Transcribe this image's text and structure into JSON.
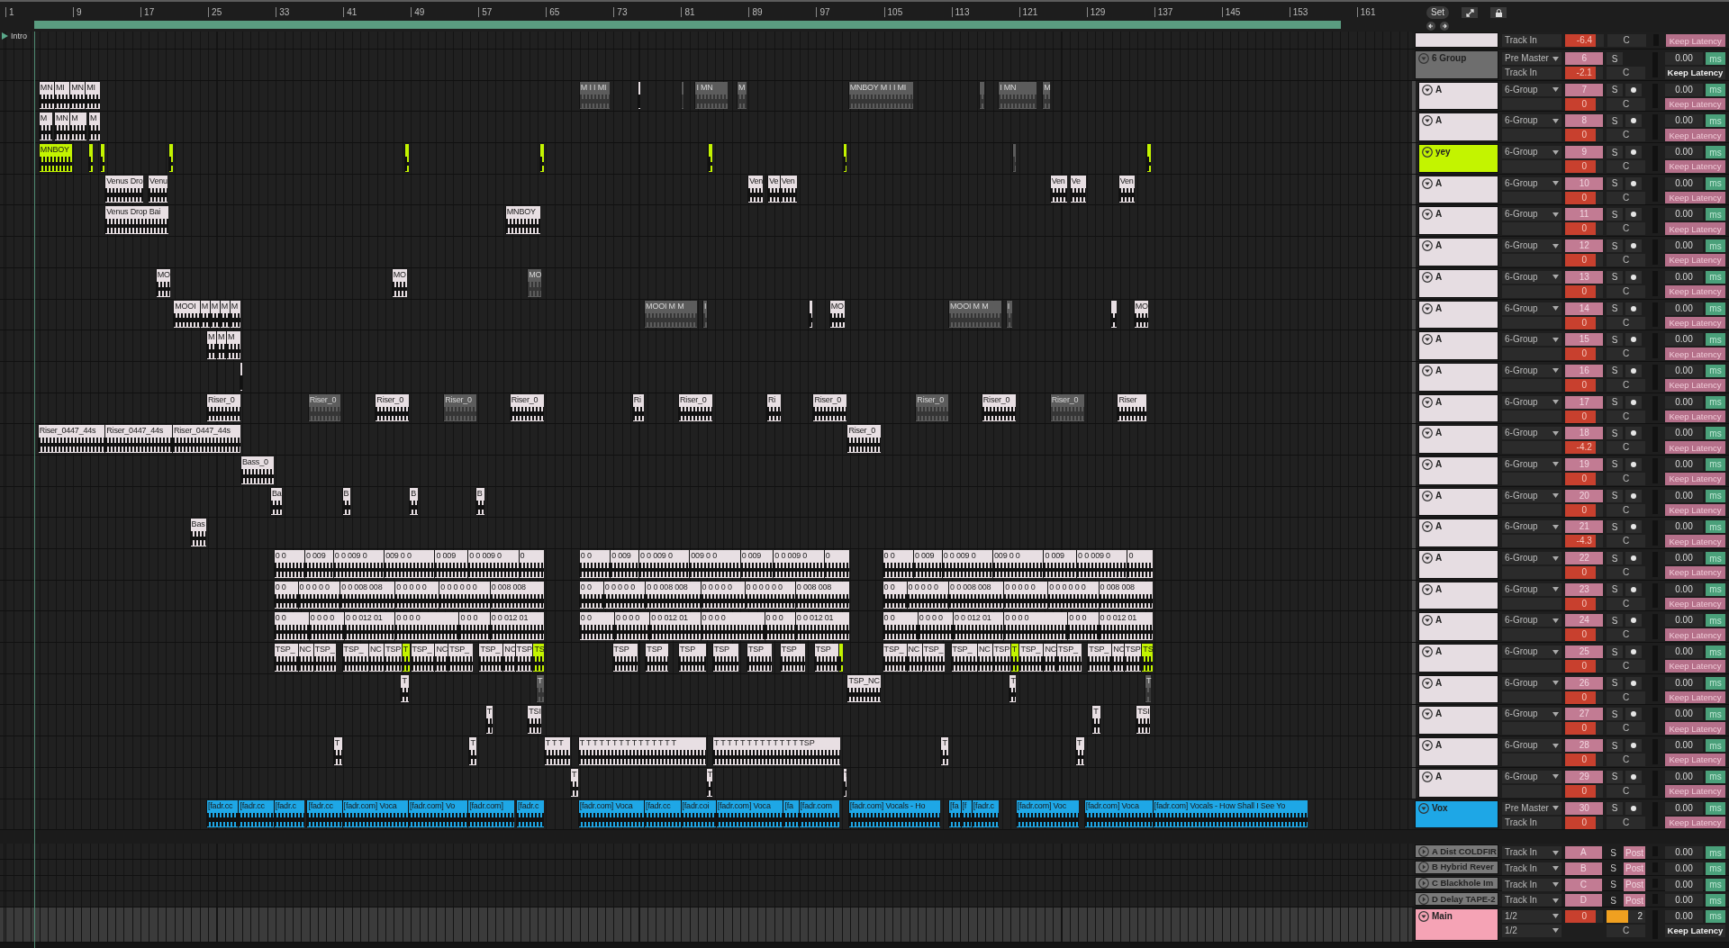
{
  "header": {
    "set_button": "Set"
  },
  "ruler": {
    "bars": [
      "1",
      "9",
      "17",
      "25",
      "33",
      "41",
      "49",
      "57",
      "65",
      "73",
      "81",
      "89",
      "97",
      "105",
      "113",
      "121",
      "129",
      "137",
      "145",
      "153",
      "161"
    ],
    "locator": "Intro"
  },
  "tracks": [
    {
      "kind": "partial",
      "color": "#e6dde2",
      "routing_sub": "Track In",
      "volume": "-6.4",
      "pan": "C",
      "keep_latency": {
        "label": "Keep Latency",
        "on": true
      }
    },
    {
      "kind": "group",
      "name": "6 Group",
      "color": "#6e6e6e",
      "expanded": true,
      "routing": "Pre Master",
      "routing_sub": "Track In",
      "number": "6",
      "volume": "-2.1",
      "solo": "S",
      "arm": false,
      "pan": "C",
      "delay": "0.00",
      "unit": "ms",
      "keep_latency": {
        "label": "Keep Latency",
        "on": false
      },
      "children": [
        {
          "kind": "track",
          "name": "A",
          "color": "#e6dde2",
          "expanded": true,
          "routing": "6-Group",
          "number": "7",
          "volume": "0",
          "solo": "S",
          "arm": true,
          "pan": "C",
          "delay": "0.00",
          "unit": "ms",
          "keep_latency": {
            "label": "Keep Latency",
            "on": true
          },
          "clips": [
            {
              "label": "MN",
              "color": "#e8dfe3",
              "active": true
            },
            {
              "label": "MI",
              "color": "#e8dfe3",
              "active": true
            },
            {
              "label": "MN",
              "color": "#e8dfe3",
              "active": true
            },
            {
              "label": "MI",
              "color": "#e8dfe3",
              "active": true
            },
            {
              "label": "M I I MI",
              "active": false
            },
            {
              "color": "#e8dfe3",
              "active": true
            },
            {
              "active": false
            },
            {
              "label": "I MN",
              "active": false
            },
            {
              "label": "M",
              "active": false
            },
            {
              "label": "MNBOY M I I MI",
              "active": false
            },
            {
              "active": false
            },
            {
              "label": "I MN",
              "active": false
            },
            {
              "label": "M",
              "active": false
            }
          ]
        },
        {
          "kind": "track",
          "name": "A",
          "color": "#e6dde2",
          "expanded": true,
          "routing": "6-Group",
          "number": "8",
          "volume": "0",
          "solo": "S",
          "arm": true,
          "pan": "C",
          "delay": "0.00",
          "unit": "ms",
          "keep_latency": {
            "label": "Keep Latency",
            "on": true
          },
          "clips": [
            {
              "label": "M",
              "color": "#e8dfe3",
              "active": true
            },
            {
              "label": "MN",
              "color": "#e8dfe3",
              "active": true
            },
            {
              "label": "M",
              "color": "#e8dfe3",
              "active": true
            },
            {
              "label": "M",
              "color": "#e8dfe3",
              "active": true
            }
          ]
        },
        {
          "kind": "track",
          "name": "yey",
          "color": "#c3f400",
          "expanded": true,
          "routing": "6-Group",
          "number": "9",
          "volume": "0",
          "solo": "S",
          "arm": true,
          "pan": "C",
          "delay": "0.00",
          "unit": "ms",
          "keep_latency": {
            "label": "Keep Latency",
            "on": true
          },
          "clips": [
            {
              "label": "MNBOY",
              "color": "#c3f400",
              "active": true
            },
            {
              "color": "#c3f400",
              "active": true
            },
            {
              "color": "#c3f400",
              "active": true
            },
            {
              "color": "#c3f400",
              "active": true
            },
            {
              "color": "#c3f400",
              "active": true
            },
            {
              "color": "#c3f400",
              "active": true
            },
            {
              "color": "#c3f400",
              "active": true
            },
            {
              "color": "#c3f400",
              "active": true
            },
            {
              "active": false
            },
            {
              "color": "#c3f400",
              "active": true
            }
          ]
        },
        {
          "kind": "track",
          "name": "A",
          "color": "#e6dde2",
          "expanded": true,
          "routing": "6-Group",
          "number": "10",
          "volume": "0",
          "solo": "S",
          "arm": true,
          "pan": "C",
          "delay": "0.00",
          "unit": "ms",
          "keep_latency": {
            "label": "Keep Latency",
            "on": true
          },
          "clips": [
            {
              "label": "Venus Dro",
              "color": "#e8dfe3",
              "active": true
            },
            {
              "label": "Venu",
              "color": "#e8dfe3",
              "active": true
            },
            {
              "label": "Ven",
              "color": "#e8dfe3",
              "active": true
            },
            {
              "label": "Ve",
              "color": "#e8dfe3",
              "active": true
            },
            {
              "label": "Ven",
              "color": "#e8dfe3",
              "active": true
            },
            {
              "label": "Ven",
              "color": "#e8dfe3",
              "active": true
            },
            {
              "label": "Ve",
              "color": "#e8dfe3",
              "active": true
            },
            {
              "label": "Ven",
              "color": "#e8dfe3",
              "active": true
            }
          ]
        },
        {
          "kind": "track",
          "name": "A",
          "color": "#e6dde2",
          "expanded": true,
          "routing": "6-Group",
          "number": "11",
          "volume": "0",
          "solo": "S",
          "arm": true,
          "pan": "C",
          "delay": "0.00",
          "unit": "ms",
          "keep_latency": {
            "label": "Keep Latency",
            "on": true
          },
          "clips": [
            {
              "label": "Venus Drop Bai",
              "color": "#e8dfe3",
              "active": true
            },
            {
              "label": "MNBOY",
              "color": "#e8dfe3",
              "active": true
            }
          ]
        },
        {
          "kind": "track",
          "name": "A",
          "color": "#e6dde2",
          "expanded": true,
          "routing": "6-Group",
          "number": "12",
          "volume": "0",
          "solo": "S",
          "arm": true,
          "pan": "C",
          "delay": "0.00",
          "unit": "ms",
          "keep_latency": {
            "label": "Keep Latency",
            "on": true
          }
        },
        {
          "kind": "track",
          "name": "A",
          "color": "#e6dde2",
          "expanded": true,
          "routing": "6-Group",
          "number": "13",
          "volume": "0",
          "solo": "S",
          "arm": true,
          "pan": "C",
          "delay": "0.00",
          "unit": "ms",
          "keep_latency": {
            "label": "Keep Latency",
            "on": true
          },
          "clips": [
            {
              "label": "MO",
              "color": "#e8dfe3",
              "active": true
            },
            {
              "label": "MO",
              "color": "#e8dfe3",
              "active": true
            },
            {
              "label": "MO",
              "active": false
            }
          ]
        },
        {
          "kind": "track",
          "name": "A",
          "color": "#e6dde2",
          "expanded": true,
          "routing": "6-Group",
          "number": "14",
          "volume": "0",
          "solo": "S",
          "arm": true,
          "pan": "C",
          "delay": "0.00",
          "unit": "ms",
          "keep_latency": {
            "label": "Keep Latency",
            "on": true
          },
          "clips": [
            {
              "label": "MOOI",
              "color": "#e8dfe3",
              "active": true
            },
            {
              "label": "M",
              "color": "#e8dfe3",
              "active": true
            },
            {
              "label": "M",
              "color": "#e8dfe3",
              "active": true
            },
            {
              "label": "M",
              "color": "#e8dfe3",
              "active": true
            },
            {
              "label": "M",
              "color": "#e8dfe3",
              "active": true
            },
            {
              "label": "MOOI M M",
              "active": false
            },
            {
              "label": "I",
              "active": false
            },
            {
              "color": "#e8dfe3",
              "active": true
            },
            {
              "label": "MO",
              "color": "#e8dfe3",
              "active": true
            },
            {
              "label": "MOOI M M",
              "active": false
            },
            {
              "label": "I",
              "active": false
            },
            {
              "color": "#e8dfe3",
              "active": true
            },
            {
              "label": "MO",
              "color": "#e8dfe3",
              "active": true
            }
          ]
        },
        {
          "kind": "track",
          "name": "A",
          "color": "#e6dde2",
          "expanded": true,
          "routing": "6-Group",
          "number": "15",
          "volume": "0",
          "solo": "S",
          "arm": true,
          "pan": "C",
          "delay": "0.00",
          "unit": "ms",
          "keep_latency": {
            "label": "Keep Latency",
            "on": true
          },
          "clips": [
            {
              "label": "M",
              "color": "#e8dfe3",
              "active": true
            },
            {
              "label": "M",
              "color": "#e8dfe3",
              "active": true
            },
            {
              "label": "M",
              "color": "#e8dfe3",
              "active": true
            }
          ]
        },
        {
          "kind": "track",
          "name": "A",
          "color": "#e6dde2",
          "expanded": true,
          "routing": "6-Group",
          "number": "16",
          "volume": "0",
          "solo": "S",
          "arm": true,
          "pan": "C",
          "delay": "0.00",
          "unit": "ms",
          "keep_latency": {
            "label": "Keep Latency",
            "on": true
          },
          "clips": [
            {
              "color": "#e8dfe3",
              "active": true
            }
          ]
        },
        {
          "kind": "track",
          "name": "A",
          "color": "#e6dde2",
          "expanded": true,
          "routing": "6-Group",
          "number": "17",
          "volume": "0",
          "solo": "S",
          "arm": true,
          "pan": "C",
          "delay": "0.00",
          "unit": "ms",
          "keep_latency": {
            "label": "Keep Latency",
            "on": true
          },
          "clips": [
            {
              "label": "Riser_0",
              "color": "#e8dfe3",
              "active": true
            },
            {
              "label": "Riser_0",
              "active": false
            },
            {
              "label": "Riser_0",
              "color": "#e8dfe3",
              "active": true
            },
            {
              "label": "Riser_0",
              "active": false
            },
            {
              "label": "Riser_0",
              "color": "#e8dfe3",
              "active": true
            },
            {
              "label": "Ri",
              "color": "#e8dfe3",
              "active": true
            },
            {
              "label": "Riser_0",
              "color": "#e8dfe3",
              "active": true
            },
            {
              "label": "Ri",
              "color": "#e8dfe3",
              "active": true
            },
            {
              "label": "Riser_0",
              "color": "#e8dfe3",
              "active": true
            },
            {
              "label": "Riser_0",
              "active": false
            },
            {
              "label": "Riser_0",
              "color": "#e8dfe3",
              "active": true
            },
            {
              "label": "Riser_0",
              "active": false
            },
            {
              "label": "Riser",
              "color": "#e8dfe3",
              "active": true
            }
          ]
        },
        {
          "kind": "track",
          "name": "A",
          "color": "#e6dde2",
          "expanded": true,
          "routing": "6-Group",
          "number": "18",
          "volume": "-4.2",
          "solo": "S",
          "arm": true,
          "pan": "C",
          "delay": "0.00",
          "unit": "ms",
          "keep_latency": {
            "label": "Keep Latency",
            "on": true
          },
          "clips": [
            {
              "label": "Riser_0447_44s",
              "color": "#e8dfe3",
              "active": true
            },
            {
              "label": "Riser_0447_44s",
              "color": "#e8dfe3",
              "active": true
            },
            {
              "label": "Riser_0447_44s",
              "color": "#e8dfe3",
              "active": true
            },
            {
              "label": "Riser_0",
              "color": "#e8dfe3",
              "active": true
            }
          ]
        },
        {
          "kind": "track",
          "name": "A",
          "color": "#e6dde2",
          "expanded": true,
          "routing": "6-Group",
          "number": "19",
          "volume": "0",
          "solo": "S",
          "arm": true,
          "pan": "C",
          "delay": "0.00",
          "unit": "ms",
          "keep_latency": {
            "label": "Keep Latency",
            "on": true
          },
          "clips": [
            {
              "label": "Bass_0",
              "color": "#e8dfe3",
              "active": true
            }
          ]
        },
        {
          "kind": "track",
          "name": "A",
          "color": "#e6dde2",
          "expanded": true,
          "routing": "6-Group",
          "number": "20",
          "volume": "0",
          "solo": "S",
          "arm": true,
          "pan": "C",
          "delay": "0.00",
          "unit": "ms",
          "keep_latency": {
            "label": "Keep Latency",
            "on": true
          },
          "clips": [
            {
              "label": "Ba",
              "color": "#e8dfe3",
              "active": true
            },
            {
              "label": "B",
              "color": "#e8dfe3",
              "active": true
            },
            {
              "label": "B",
              "color": "#e8dfe3",
              "active": true
            },
            {
              "label": "B",
              "color": "#e8dfe3",
              "active": true
            }
          ]
        },
        {
          "kind": "track",
          "name": "A",
          "color": "#e6dde2",
          "expanded": true,
          "routing": "6-Group",
          "number": "21",
          "volume": "-4.3",
          "solo": "S",
          "arm": true,
          "pan": "C",
          "delay": "0.00",
          "unit": "ms",
          "keep_latency": {
            "label": "Keep Latency",
            "on": true
          },
          "clips": [
            {
              "label": "Bas",
              "color": "#e8dfe3",
              "active": true
            }
          ]
        },
        {
          "kind": "track",
          "name": "A",
          "color": "#e6dde2",
          "expanded": true,
          "routing": "6-Group",
          "number": "22",
          "volume": "0",
          "solo": "S",
          "arm": true,
          "pan": "C",
          "delay": "0.00",
          "unit": "ms",
          "keep_latency": {
            "label": "Keep Latency",
            "on": true
          },
          "clips": [
            {
              "label": "0 0",
              "color": "#e8dfe3",
              "active": true
            },
            {
              "label": "0 009",
              "color": "#e8dfe3",
              "active": true
            },
            {
              "label": "0 0 009 0",
              "color": "#e8dfe3",
              "active": true
            },
            {
              "label": "009 0 0",
              "color": "#e8dfe3",
              "active": true
            },
            {
              "label": "0 009",
              "color": "#e8dfe3",
              "active": true
            },
            {
              "label": "0 0 009 0",
              "color": "#e8dfe3",
              "active": true
            },
            {
              "label": "0",
              "color": "#e8dfe3",
              "active": true
            },
            {
              "label": "0 0",
              "color": "#e8dfe3",
              "active": true
            },
            {
              "label": "0 009",
              "color": "#e8dfe3",
              "active": true
            },
            {
              "label": "0 0 009 0",
              "color": "#e8dfe3",
              "active": true
            },
            {
              "label": "009 0 0",
              "color": "#e8dfe3",
              "active": true
            },
            {
              "label": "0 009",
              "color": "#e8dfe3",
              "active": true
            },
            {
              "label": "0 0 009 0",
              "color": "#e8dfe3",
              "active": true
            },
            {
              "label": "0",
              "color": "#e8dfe3",
              "active": true
            },
            {
              "label": "0 0",
              "color": "#e8dfe3",
              "active": true
            },
            {
              "label": "0 009",
              "color": "#e8dfe3",
              "active": true
            },
            {
              "label": "0 0 009 0",
              "color": "#e8dfe3",
              "active": true
            },
            {
              "label": "009 0 0",
              "color": "#e8dfe3",
              "active": true
            },
            {
              "label": "0 009",
              "color": "#e8dfe3",
              "active": true
            },
            {
              "label": "0 0 009 0",
              "color": "#e8dfe3",
              "active": true
            },
            {
              "label": "0",
              "color": "#e8dfe3",
              "active": true
            }
          ]
        },
        {
          "kind": "track",
          "name": "A",
          "color": "#e6dde2",
          "expanded": true,
          "routing": "6-Group",
          "number": "23",
          "volume": "0",
          "solo": "S",
          "arm": true,
          "pan": "C",
          "delay": "0.00",
          "unit": "ms",
          "keep_latency": {
            "label": "Keep Latency",
            "on": true
          },
          "clips": [
            {
              "label": "0 0",
              "color": "#e8dfe3",
              "active": true
            },
            {
              "label": "0 0 0 0 0",
              "color": "#e8dfe3",
              "active": true
            },
            {
              "label": "0 0 008 008",
              "color": "#e8dfe3",
              "active": true
            },
            {
              "label": "0 0 0 0 0",
              "color": "#e8dfe3",
              "active": true
            },
            {
              "label": "0 0 0 0 0 0",
              "color": "#e8dfe3",
              "active": true
            },
            {
              "label": "0 008 008",
              "color": "#e8dfe3",
              "active": true
            },
            {
              "label": "0 0",
              "color": "#e8dfe3",
              "active": true
            },
            {
              "label": "0 0 0 0 0",
              "color": "#e8dfe3",
              "active": true
            },
            {
              "label": "0 0 008 008",
              "color": "#e8dfe3",
              "active": true
            },
            {
              "label": "0 0 0 0 0",
              "color": "#e8dfe3",
              "active": true
            },
            {
              "label": "0 0 0 0 0 0",
              "color": "#e8dfe3",
              "active": true
            },
            {
              "label": "0 008 008",
              "color": "#e8dfe3",
              "active": true
            },
            {
              "label": "0 0",
              "color": "#e8dfe3",
              "active": true
            },
            {
              "label": "0 0 0 0 0",
              "color": "#e8dfe3",
              "active": true
            },
            {
              "label": "0 0 008 008",
              "color": "#e8dfe3",
              "active": true
            },
            {
              "label": "0 0 0 0 0",
              "color": "#e8dfe3",
              "active": true
            },
            {
              "label": "0 0 0 0 0 0",
              "color": "#e8dfe3",
              "active": true
            },
            {
              "label": "0 008 008",
              "color": "#e8dfe3",
              "active": true
            }
          ]
        },
        {
          "kind": "track",
          "name": "A",
          "color": "#e6dde2",
          "expanded": true,
          "routing": "6-Group",
          "number": "24",
          "volume": "0",
          "solo": "S",
          "arm": true,
          "pan": "C",
          "delay": "0.00",
          "unit": "ms",
          "keep_latency": {
            "label": "Keep Latency",
            "on": true
          },
          "clips": [
            {
              "label": "0 0",
              "color": "#e8dfe3",
              "active": true
            },
            {
              "label": "0 0 0 0",
              "color": "#e8dfe3",
              "active": true
            },
            {
              "label": "0 0 012 01",
              "color": "#e8dfe3",
              "active": true
            },
            {
              "label": "0 0 0 0",
              "color": "#e8dfe3",
              "active": true
            },
            {
              "label": "0 0 0",
              "color": "#e8dfe3",
              "active": true
            },
            {
              "label": "0 0 012 01",
              "color": "#e8dfe3",
              "active": true
            },
            {
              "label": "0 0",
              "color": "#e8dfe3",
              "active": true
            },
            {
              "label": "0 0 0 0",
              "color": "#e8dfe3",
              "active": true
            },
            {
              "label": "0 0 012 01",
              "color": "#e8dfe3",
              "active": true
            },
            {
              "label": "0 0 0 0",
              "color": "#e8dfe3",
              "active": true
            },
            {
              "label": "0 0 0",
              "color": "#e8dfe3",
              "active": true
            },
            {
              "label": "0 0 012 01",
              "color": "#e8dfe3",
              "active": true
            },
            {
              "label": "0 0",
              "color": "#e8dfe3",
              "active": true
            },
            {
              "label": "0 0 0 0",
              "color": "#e8dfe3",
              "active": true
            },
            {
              "label": "0 0 012 01",
              "color": "#e8dfe3",
              "active": true
            },
            {
              "label": "0 0 0 0",
              "color": "#e8dfe3",
              "active": true
            },
            {
              "label": "0 0 0",
              "color": "#e8dfe3",
              "active": true
            },
            {
              "label": "0 0 012 01",
              "color": "#e8dfe3",
              "active": true
            }
          ]
        },
        {
          "kind": "track",
          "name": "A",
          "color": "#e6dde2",
          "expanded": true,
          "routing": "6-Group",
          "number": "25",
          "volume": "0",
          "solo": "S",
          "arm": true,
          "pan": "C",
          "delay": "0.00",
          "unit": "ms",
          "keep_latency": {
            "label": "Keep Latency",
            "on": true
          },
          "clips": [
            {
              "label": "TSP_",
              "color": "#e8dfe3",
              "active": true
            },
            {
              "label": "NC",
              "color": "#e8dfe3",
              "active": true
            },
            {
              "label": "TSP_",
              "color": "#e8dfe3",
              "active": true
            },
            {
              "label": "TSP_",
              "color": "#e8dfe3",
              "active": true
            },
            {
              "label": "NC",
              "color": "#e8dfe3",
              "active": true
            },
            {
              "label": "TSP",
              "color": "#e8dfe3",
              "active": true
            },
            {
              "label": "T",
              "color": "#c3f400",
              "active": true
            },
            {
              "label": "TSP_",
              "color": "#e8dfe3",
              "active": true
            },
            {
              "label": "NC",
              "color": "#e8dfe3",
              "active": true
            },
            {
              "label": "TSP_",
              "color": "#e8dfe3",
              "active": true
            },
            {
              "label": "TSP_",
              "color": "#e8dfe3",
              "active": true
            },
            {
              "label": "NC",
              "color": "#e8dfe3",
              "active": true
            },
            {
              "label": "TSP",
              "color": "#e8dfe3",
              "active": true
            },
            {
              "label": "TS",
              "color": "#c3f400",
              "active": true
            },
            {
              "label": "TSP",
              "color": "#e8dfe3",
              "active": true
            },
            {
              "label": "TSP",
              "color": "#e8dfe3",
              "active": true
            },
            {
              "label": "TSP",
              "color": "#e8dfe3",
              "active": true
            },
            {
              "label": "TSP",
              "color": "#e8dfe3",
              "active": true
            },
            {
              "label": "TSP",
              "color": "#e8dfe3",
              "active": true
            },
            {
              "label": "TSP",
              "color": "#e8dfe3",
              "active": true
            },
            {
              "label": "TSP",
              "color": "#e8dfe3",
              "active": true
            },
            {
              "color": "#c3f400",
              "active": true
            },
            {
              "label": "TSP_",
              "color": "#e8dfe3",
              "active": true
            },
            {
              "label": "NC",
              "color": "#e8dfe3",
              "active": true
            },
            {
              "label": "TSP_",
              "color": "#e8dfe3",
              "active": true
            },
            {
              "label": "TSP_",
              "color": "#e8dfe3",
              "active": true
            },
            {
              "label": "NC",
              "color": "#e8dfe3",
              "active": true
            },
            {
              "label": "TSP",
              "color": "#e8dfe3",
              "active": true
            },
            {
              "label": "T",
              "color": "#c3f400",
              "active": true
            },
            {
              "label": "TSP_",
              "color": "#e8dfe3",
              "active": true
            },
            {
              "label": "NC",
              "color": "#e8dfe3",
              "active": true
            },
            {
              "label": "TSP_",
              "color": "#e8dfe3",
              "active": true
            },
            {
              "label": "TSP_",
              "color": "#e8dfe3",
              "active": true
            },
            {
              "label": "NC",
              "color": "#e8dfe3",
              "active": true
            },
            {
              "label": "TSP",
              "color": "#e8dfe3",
              "active": true
            },
            {
              "label": "TS",
              "color": "#c3f400",
              "active": true
            }
          ]
        },
        {
          "kind": "track",
          "name": "A",
          "color": "#e6dde2",
          "expanded": true,
          "routing": "6-Group",
          "number": "26",
          "volume": "0",
          "solo": "S",
          "arm": true,
          "pan": "C",
          "delay": "0.00",
          "unit": "ms",
          "keep_latency": {
            "label": "Keep Latency",
            "on": true
          },
          "clips": [
            {
              "label": "T",
              "color": "#e8dfe3",
              "active": true
            },
            {
              "label": "T",
              "active": false
            },
            {
              "label": "TSP_NC",
              "color": "#e8dfe3",
              "active": true
            },
            {
              "label": "T",
              "color": "#e8dfe3",
              "active": true
            },
            {
              "label": "T",
              "active": false
            }
          ]
        },
        {
          "kind": "track",
          "name": "A",
          "color": "#e6dde2",
          "expanded": true,
          "routing": "6-Group",
          "number": "27",
          "volume": "0",
          "solo": "S",
          "arm": true,
          "pan": "C",
          "delay": "0.00",
          "unit": "ms",
          "keep_latency": {
            "label": "Keep Latency",
            "on": true
          },
          "clips": [
            {
              "label": "T",
              "color": "#e8dfe3",
              "active": true
            },
            {
              "label": "TSI",
              "color": "#e8dfe3",
              "active": true
            },
            {
              "label": "T",
              "color": "#e8dfe3",
              "active": true
            },
            {
              "label": "TSI",
              "color": "#e8dfe3",
              "active": true
            }
          ]
        },
        {
          "kind": "track",
          "name": "A",
          "color": "#e6dde2",
          "expanded": true,
          "routing": "6-Group",
          "number": "28",
          "volume": "0",
          "solo": "S",
          "arm": true,
          "pan": "C",
          "delay": "0.00",
          "unit": "ms",
          "keep_latency": {
            "label": "Keep Latency",
            "on": true
          },
          "clips": [
            {
              "label": "T",
              "color": "#e8dfe3",
              "active": true
            },
            {
              "label": "T",
              "color": "#e8dfe3",
              "active": true
            },
            {
              "label": "T T T",
              "color": "#e8dfe3",
              "active": true
            },
            {
              "label": "T T T T T T T T T T T T T T T",
              "color": "#e8dfe3",
              "active": true
            },
            {
              "label": "T T T T T T T T T T T T T TSP",
              "color": "#e8dfe3",
              "active": true
            },
            {
              "label": "T",
              "color": "#e8dfe3",
              "active": true
            },
            {
              "label": "T",
              "color": "#e8dfe3",
              "active": true
            }
          ]
        },
        {
          "kind": "track",
          "name": "A",
          "color": "#e6dde2",
          "expanded": true,
          "routing": "6-Group",
          "number": "29",
          "volume": "0",
          "solo": "S",
          "arm": true,
          "pan": "C",
          "delay": "0.00",
          "unit": "ms",
          "keep_latency": {
            "label": "Keep Latency",
            "on": true
          },
          "clips": [
            {
              "label": "T",
              "color": "#e8dfe3",
              "active": true
            },
            {
              "label": "T",
              "color": "#e8dfe3",
              "active": true
            },
            {
              "label": "T",
              "color": "#e8dfe3",
              "active": true
            }
          ]
        }
      ]
    },
    {
      "kind": "track",
      "name": "Vox",
      "color": "#1ea7e6",
      "expanded": true,
      "routing": "Pre Master",
      "routing_sub": "Track In",
      "number": "30",
      "volume": "0",
      "solo": "S",
      "arm": true,
      "pan": "C",
      "delay": "0.00",
      "unit": "ms",
      "keep_latency": {
        "label": "Keep Latency",
        "on": true
      },
      "clips": [
        {
          "label": "[fadr.cc",
          "color": "#1ea7e6",
          "active": true
        },
        {
          "label": "[fadr.cc",
          "color": "#1ea7e6",
          "active": true
        },
        {
          "label": "[fadr.c",
          "color": "#1ea7e6",
          "active": true
        },
        {
          "label": "[fadr.cc",
          "color": "#1ea7e6",
          "active": true
        },
        {
          "label": "[fadr.com] Voca",
          "color": "#1ea7e6",
          "active": true
        },
        {
          "label": "[fadr.com] Vo",
          "color": "#1ea7e6",
          "active": true
        },
        {
          "label": "[fadr.com]",
          "color": "#1ea7e6",
          "active": true
        },
        {
          "label": "[fadr.c",
          "color": "#1ea7e6",
          "active": true
        },
        {
          "label": "[fadr.com] Voca",
          "color": "#1ea7e6",
          "active": true
        },
        {
          "label": "[fadr.cc",
          "color": "#1ea7e6",
          "active": true
        },
        {
          "label": "[fadr.coi",
          "color": "#1ea7e6",
          "active": true
        },
        {
          "label": "[fadr.com] Voca",
          "color": "#1ea7e6",
          "active": true
        },
        {
          "label": "[fa",
          "color": "#1ea7e6",
          "active": true
        },
        {
          "label": "[fadr.com",
          "color": "#1ea7e6",
          "active": true
        },
        {
          "label": "[fadr.com] Vocals - Ho",
          "color": "#1ea7e6",
          "active": true
        },
        {
          "label": "[fa",
          "color": "#1ea7e6",
          "active": true
        },
        {
          "label": "[f",
          "color": "#1ea7e6",
          "active": true
        },
        {
          "label": "[fadr.c",
          "color": "#1ea7e6",
          "active": true
        },
        {
          "label": "[fadr.com] Voc",
          "color": "#1ea7e6",
          "active": true
        },
        {
          "label": "[fadr.com] Voca",
          "color": "#1ea7e6",
          "active": true
        },
        {
          "label": "[fadr.com] Vocals - How Shall I See Yo",
          "color": "#1ea7e6",
          "active": true
        }
      ]
    }
  ],
  "returns": [
    {
      "name": "A Dist COLDFIR",
      "color": "#7a7a7a",
      "expanded": false,
      "routing": "Track In",
      "number": "A",
      "solo": "S",
      "send_mode": "Post",
      "delay": "0.00",
      "unit": "ms"
    },
    {
      "name": "B Hybrid Rever",
      "color": "#7a7a7a",
      "expanded": false,
      "routing": "Track In",
      "number": "B",
      "solo": "S",
      "send_mode": "Post",
      "delay": "0.00",
      "unit": "ms"
    },
    {
      "name": "C Blackhole Im",
      "color": "#7a7a7a",
      "expanded": false,
      "routing": "Track In",
      "number": "C",
      "solo": "S",
      "send_mode": "Post",
      "delay": "0.00",
      "unit": "ms"
    },
    {
      "name": "D Delay TAPE-2",
      "color": "#7a7a7a",
      "expanded": false,
      "routing": "Track In",
      "number": "D",
      "solo": "S",
      "send_mode": "Post",
      "delay": "0.00",
      "unit": "ms"
    }
  ],
  "main": {
    "name": "Main",
    "color": "#f5a3b5",
    "expanded": true,
    "routing": "1/2",
    "routing_sub": "1/2",
    "volume": "0",
    "pan_value": "2",
    "level": 0.6,
    "pan": "C",
    "delay": "0.00",
    "unit": "ms",
    "keep_latency": {
      "label": "Keep Latency",
      "on": false
    }
  }
}
